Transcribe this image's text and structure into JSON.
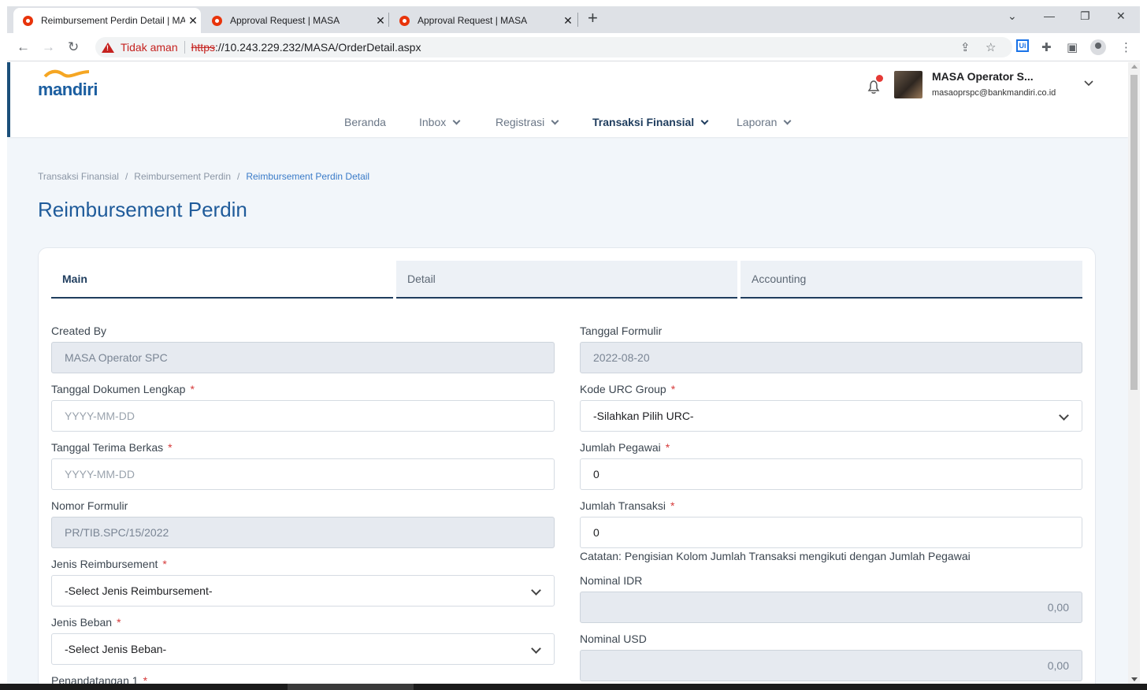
{
  "browser": {
    "tabs": [
      {
        "title": "Reimbursement Perdin Detail | MASA",
        "active": true
      },
      {
        "title": "Approval Request | MASA",
        "active": false
      },
      {
        "title": "Approval Request | MASA",
        "active": false
      }
    ],
    "security_label": "Tidak aman",
    "url_scheme": "https",
    "url_rest": "://10.243.229.232/MASA/OrderDetail.aspx"
  },
  "header": {
    "logo_text": "mandiri",
    "user_name": "MASA Operator S...",
    "user_email": "masaoprspc@bankmandiri.co.id",
    "nav": [
      {
        "label": "Beranda"
      },
      {
        "label": "Inbox"
      },
      {
        "label": "Registrasi"
      },
      {
        "label": "Transaksi Finansial"
      },
      {
        "label": "Laporan"
      }
    ]
  },
  "breadcrumb": [
    "Transaksi Finansial",
    "Reimbursement Perdin",
    "Reimbursement Perdin Detail"
  ],
  "page_title": "Reimbursement Perdin",
  "form_tabs": [
    "Main",
    "Detail",
    "Accounting"
  ],
  "form": {
    "left": {
      "created_by": {
        "label": "Created By",
        "value": "MASA Operator SPC"
      },
      "tgl_dok": {
        "label": "Tanggal Dokumen Lengkap",
        "placeholder": "YYYY-MM-DD"
      },
      "tgl_terima": {
        "label": "Tanggal Terima Berkas",
        "placeholder": "YYYY-MM-DD"
      },
      "nomor": {
        "label": "Nomor Formulir",
        "value": "PR/TIB.SPC/15/2022"
      },
      "jenis_reimb": {
        "label": "Jenis Reimbursement",
        "value": "-Select Jenis Reimbursement-"
      },
      "jenis_beban": {
        "label": "Jenis Beban",
        "value": "-Select Jenis Beban-"
      },
      "penandatangan": {
        "label": "Penandatangan 1"
      }
    },
    "right": {
      "tgl_formulir": {
        "label": "Tanggal Formulir",
        "value": "2022-08-20"
      },
      "urc": {
        "label": "Kode URC Group",
        "value": "-Silahkan Pilih URC-"
      },
      "jml_pegawai": {
        "label": "Jumlah Pegawai",
        "value": "0"
      },
      "jml_transaksi": {
        "label": "Jumlah Transaksi",
        "value": "0"
      },
      "catatan": "Catatan: Pengisian Kolom Jumlah Transaksi mengikuti dengan Jumlah Pegawai",
      "nominal_idr": {
        "label": "Nominal IDR",
        "value": "0,00"
      },
      "nominal_usd": {
        "label": "Nominal USD",
        "value": "0,00"
      }
    },
    "required_mark": "*"
  }
}
